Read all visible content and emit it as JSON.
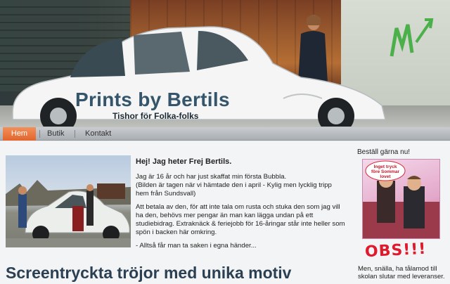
{
  "header": {
    "title": "Prints by Bertils",
    "subtitle": "Tishor för Folka-folks"
  },
  "nav": {
    "items": [
      {
        "label": "Hem",
        "active": true
      },
      {
        "label": "Butik",
        "active": false
      },
      {
        "label": "Kontakt",
        "active": false
      }
    ]
  },
  "intro": {
    "heading": "Hej! Jag heter Frej Bertils.",
    "p1": "Jag är 16 år och har just skaffat min första Bubbla.",
    "p1b": "(Bilden är tagen när vi hämtade den i april - Kylig men lycklig tripp hem från Sundsvall)",
    "p2": "Att betala av den, för att inte tala om rusta och stuka den som jag vill ha den, behövs mer pengar än man kan lägga undan på ett studiebidrag. Extraknäck & feriejobb för 16-åringar står inte heller som spön i backen här omkring.",
    "p3": "- Alltså får man ta saken i egna händer..."
  },
  "main_heading": "Screentryckta tröjor med unika motiv",
  "aside": {
    "title": "Beställ gärna nu!",
    "bubble": "Inget tryck före Sommar lovet",
    "obs": "OBS!!!",
    "note": "Men, snälla, ha tålamod till skolan slutar med leveranser."
  },
  "colors": {
    "accent": "#e2652c",
    "title": "#34556c",
    "obs": "#e0192c"
  }
}
